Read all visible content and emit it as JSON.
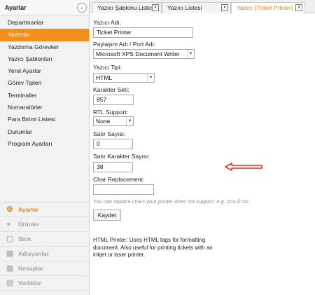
{
  "sidebar": {
    "title": "Ayarlar",
    "items": [
      {
        "label": "Departmanlar"
      },
      {
        "label": "Yazıcılar",
        "active": true
      },
      {
        "label": "Yazdırma Görevleri"
      },
      {
        "label": "Yazıcı Şablonları"
      },
      {
        "label": "Yerel Ayarlar"
      },
      {
        "label": "Görev Tipleri"
      },
      {
        "label": "Terminaller"
      },
      {
        "label": "Numaratörler"
      },
      {
        "label": "Para Birimi Listesi"
      },
      {
        "label": "Durumlar"
      },
      {
        "label": "Program Ayarları"
      }
    ],
    "modules": [
      {
        "label": "Ayarlar",
        "icon": "gear-icon",
        "active": true
      },
      {
        "label": "Ürünler",
        "icon": "product-icon"
      },
      {
        "label": "Stok",
        "icon": "stock-icon"
      },
      {
        "label": "Adisyonlar",
        "icon": "tickets-icon"
      },
      {
        "label": "Hesaplar",
        "icon": "accounts-icon"
      },
      {
        "label": "Varlıklar",
        "icon": "entities-icon"
      }
    ]
  },
  "tabs": [
    {
      "label": "Yazıcı Şablonu Listesi",
      "close": "x"
    },
    {
      "label": "Yazıcı Listesi",
      "close": "x"
    },
    {
      "label": "Yazıcı (Ticket Printer)",
      "close": "x",
      "active": true
    }
  ],
  "form": {
    "name_label": "Yazıcı Adı:",
    "name_value": "Ticket Printer",
    "share_label": "Paylaşım Adı / Port Adı:",
    "share_value": "Microsoft XPS Document Writer",
    "type_label": "Yazıcı Tipi:",
    "type_value": "HTML",
    "charset_label": "Karakter Seti:",
    "charset_value": "857",
    "rtl_label": "RTL Support:",
    "rtl_value": "None",
    "line_count_label": "Satır Sayısı:",
    "line_count_value": "0",
    "line_chars_label": "Satır Karakter Sayısı:",
    "line_chars_value": "38",
    "char_repl_label": "Char Replacement:",
    "char_repl_value": "",
    "char_repl_hint": "You can replace chars your printer does not support. e.g. ö=o,ß=ss",
    "save_label": "Kaydet",
    "info_text": "HTML Printer: Uses HTML tags for formatting document. Also useful for printing tickets with an inkjet or laser printer."
  },
  "colors": {
    "accent": "#f28f1c",
    "arrow": "#d9342b"
  }
}
